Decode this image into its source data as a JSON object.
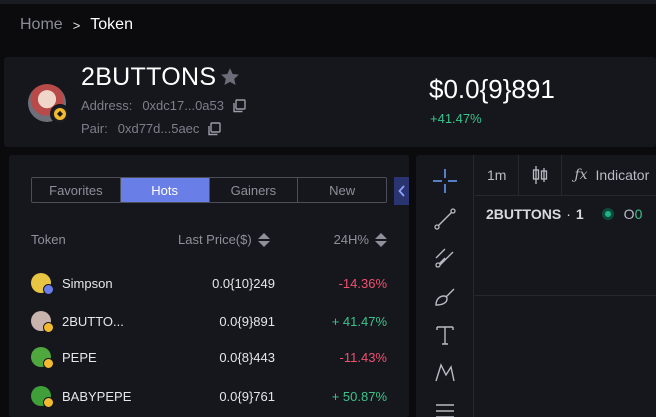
{
  "breadcrumb": {
    "home": "Home",
    "separator": ">",
    "current": "Token"
  },
  "token": {
    "name": "2BUTTONS",
    "address_label": "Address:",
    "address": "0xdc17...0a53",
    "pair_label": "Pair:",
    "pair": "0xd77d...5aec",
    "price": "$0.0{9}891",
    "change_24h": "+41.47%"
  },
  "tabs": [
    {
      "label": "Favorites",
      "active": false
    },
    {
      "label": "Hots",
      "active": true
    },
    {
      "label": "Gainers",
      "active": false
    },
    {
      "label": "New",
      "active": false
    }
  ],
  "columns": {
    "token": "Token",
    "last_price": "Last Price($)",
    "change": "24H%"
  },
  "rows": [
    {
      "name": "Simpson",
      "price": "0.0{10}249",
      "change": "-14.36%",
      "direction": "down",
      "icon": "simpson-icon",
      "icon_color": "#e8c542",
      "badge_color": "#6a7ee8"
    },
    {
      "name": "2BUTTO...",
      "price": "0.0{9}891",
      "change": "+ 41.47%",
      "direction": "up",
      "icon": "2buttons-icon",
      "icon_color": "#c9b3ad",
      "badge_color": "#f3ba2f"
    },
    {
      "name": "PEPE",
      "price": "0.0{8}443",
      "change": "-11.43%",
      "direction": "down",
      "icon": "pepe-icon",
      "icon_color": "#4fa83d",
      "badge_color": "#f3ba2f"
    },
    {
      "name": "BABYPEPE",
      "price": "0.0{9}761",
      "change": "+ 50.87%",
      "direction": "up",
      "icon": "babypepe-icon",
      "icon_color": "#3f9f38",
      "badge_color": "#f3ba2f"
    }
  ],
  "chart": {
    "toolbar": {
      "interval": "1m",
      "indicators": "Indicator"
    },
    "legend": {
      "symbol": "2BUTTONS",
      "sep": "·",
      "interval": "1",
      "ohlc_prefix": "O",
      "ohlc_value": "0"
    }
  },
  "colors": {
    "accent": "#6a7ee8",
    "positive": "#3cc38a",
    "negative": "#f0506e",
    "bsc": "#f3ba2f"
  }
}
